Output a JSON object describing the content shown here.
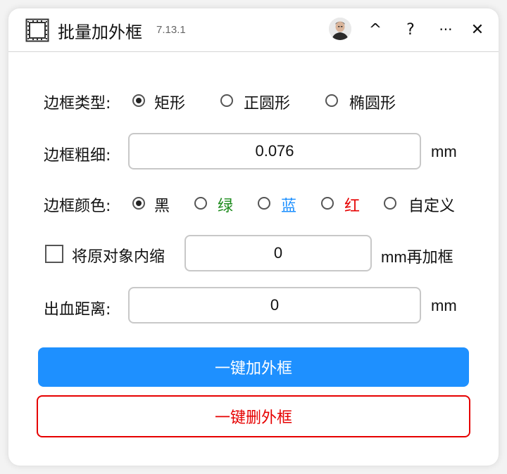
{
  "window": {
    "title": "批量加外框",
    "version": "7.13.1",
    "buttons": {
      "collapse": "^",
      "help": "?",
      "more": "···",
      "close": "✕"
    }
  },
  "border_type": {
    "label": "边框类型:",
    "options": [
      "矩形",
      "正圆形",
      "椭圆形"
    ],
    "selected": "矩形"
  },
  "border_width": {
    "label": "边框粗细:",
    "value": "0.076",
    "unit": "mm"
  },
  "border_color": {
    "label": "边框颜色:",
    "options": [
      {
        "label": "黑",
        "color": "#111111"
      },
      {
        "label": "绿",
        "color": "#1a8a1a"
      },
      {
        "label": "蓝",
        "color": "#1e90ff"
      },
      {
        "label": "红",
        "color": "#e60000"
      },
      {
        "label": "自定义",
        "color": "#111111"
      }
    ],
    "selected": "黑"
  },
  "shrink": {
    "label": "将原对象内缩",
    "checked": false,
    "value": "0",
    "unit": "mm再加框"
  },
  "bleed": {
    "label": "出血距离:",
    "value": "0",
    "unit": "mm"
  },
  "actions": {
    "add_label": "一键加外框",
    "remove_label": "一键删外框"
  }
}
